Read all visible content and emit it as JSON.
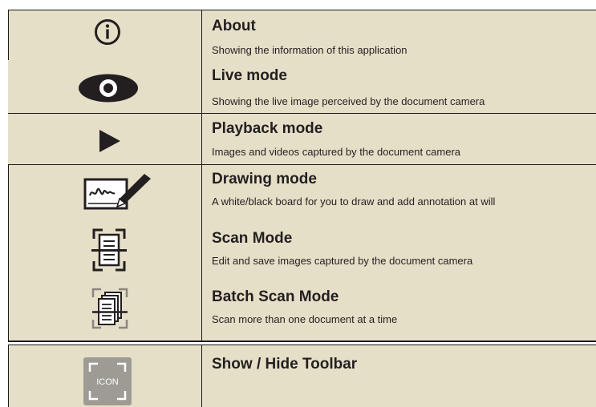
{
  "items": [
    {
      "icon": "info-icon",
      "title": "About",
      "desc": "Showing the information of this application"
    },
    {
      "icon": "eye-icon",
      "title": "Live mode",
      "desc": "Showing the live image perceived by the document camera"
    },
    {
      "icon": "play-icon",
      "title": "Playback mode",
      "desc": "Images and videos captured by the document camera"
    },
    {
      "icon": "pen-signature-icon",
      "title": "Drawing mode",
      "desc": "A white/black board for you to draw and add annotation at will"
    },
    {
      "icon": "scan-document-icon",
      "title": "Scan Mode",
      "desc": "Edit and save images captured by the document camera"
    },
    {
      "icon": "batch-scan-icon",
      "title": "Batch Scan Mode",
      "desc": "Scan more than one document at a time"
    }
  ],
  "toolbar_item": {
    "icon": "toolbar-placeholder-icon",
    "icon_label": "ICON",
    "title": "Show / Hide Toolbar"
  },
  "colors": {
    "panel_background": "#e6dfc8",
    "line": "#1a1a1a",
    "icon": "#231f20",
    "placeholder_icon": "#9e9b95"
  }
}
